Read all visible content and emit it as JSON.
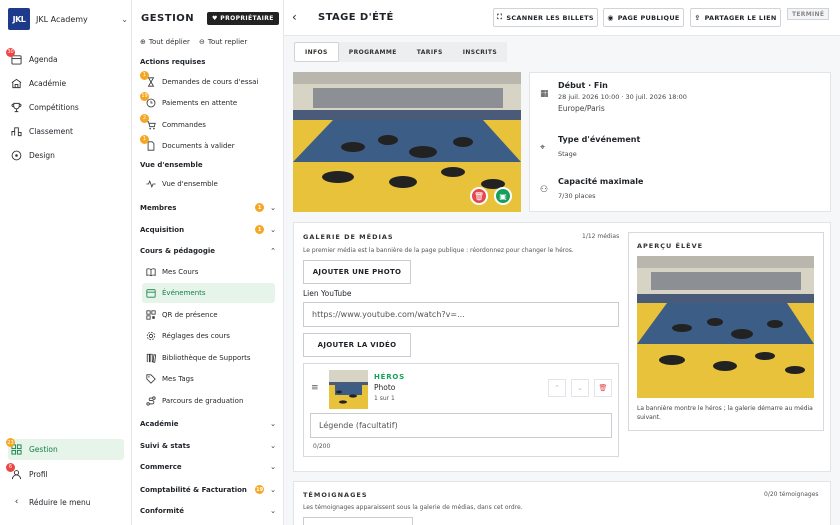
{
  "brand": {
    "logo": "JKL",
    "name": "JKL Academy"
  },
  "rail": {
    "items": [
      {
        "label": "Agenda",
        "badge": "30"
      },
      {
        "label": "Académie"
      },
      {
        "label": "Compétitions"
      },
      {
        "label": "Classement"
      },
      {
        "label": "Design"
      }
    ],
    "gestion": {
      "label": "Gestion",
      "badge": "23"
    },
    "profil": {
      "label": "Profil",
      "badge": "6"
    },
    "collapse": "Réduire le menu"
  },
  "gestion": {
    "title": "GESTION",
    "owner": "PROPRIÉTAIRE",
    "expand_all": "Tout déplier",
    "collapse_all": "Tout replier",
    "actions_title": "Actions requises",
    "actions": [
      {
        "label": "Demandes de cours d'essai",
        "badge": "1"
      },
      {
        "label": "Paiements en attente",
        "badge": "19"
      },
      {
        "label": "Commandes",
        "badge": "2"
      },
      {
        "label": "Documents à valider",
        "badge": "1"
      }
    ],
    "overview_title": "Vue d'ensemble",
    "overview_item": "Vue d'ensemble",
    "membres": {
      "label": "Membres",
      "badge": "1"
    },
    "acquisition": {
      "label": "Acquisition",
      "badge": "1"
    },
    "cours_title": "Cours & pédagogie",
    "cours_items": [
      "Mes Cours",
      "Événements",
      "QR de présence",
      "Réglages des cours",
      "Bibliothèque de Supports",
      "Mes Tags",
      "Parcours de graduation"
    ],
    "academie": "Académie",
    "suivi": "Suivi & stats",
    "commerce": "Commerce",
    "compta": {
      "label": "Comptabilité & Facturation",
      "badge": "19"
    },
    "conformite": "Conformité"
  },
  "main": {
    "title": "STAGE D'ÉTÉ",
    "scan": "SCANNER LES BILLETS",
    "public": "PAGE PUBLIQUE",
    "share": "PARTAGER LE LIEN",
    "status": "TERMINÉ",
    "tabs": [
      "INFOS",
      "PROGRAMME",
      "TARIFS",
      "INSCRITS"
    ],
    "info": {
      "date_label": "Début · Fin",
      "date_value": "28 juil. 2026 10:00 · 30 juil. 2026 18:00",
      "tz": "Europe/Paris",
      "type_label": "Type d'événement",
      "type_value": "Stage",
      "cap_label": "Capacité maximale",
      "cap_value": "7/30 places"
    },
    "gallery": {
      "title": "GALERIE DE MÉDIAS",
      "count": "1/12 médias",
      "hint": "Le premier média est la bannière de la page publique : réordonnez pour changer le héros.",
      "add_photo": "AJOUTER UNE PHOTO",
      "yt_label": "Lien YouTube",
      "yt_placeholder": "https://www.youtube.com/watch?v=...",
      "add_video": "AJOUTER LA VIDÉO",
      "item_role": "HÉROS",
      "item_type": "Photo",
      "item_pos": "1 sur 1",
      "caption_placeholder": "Légende (facultatif)",
      "caption_count": "0/200"
    },
    "preview": {
      "title": "APERÇU ÉLÈVE",
      "note": "La bannière montre le héros ; la galerie démarre au média suivant."
    },
    "testimonials": {
      "title": "TÉMOIGNAGES",
      "count": "0/20 témoignages",
      "hint": "Les témoignages apparaissent sous la galerie de médias, dans cet ordre."
    }
  }
}
